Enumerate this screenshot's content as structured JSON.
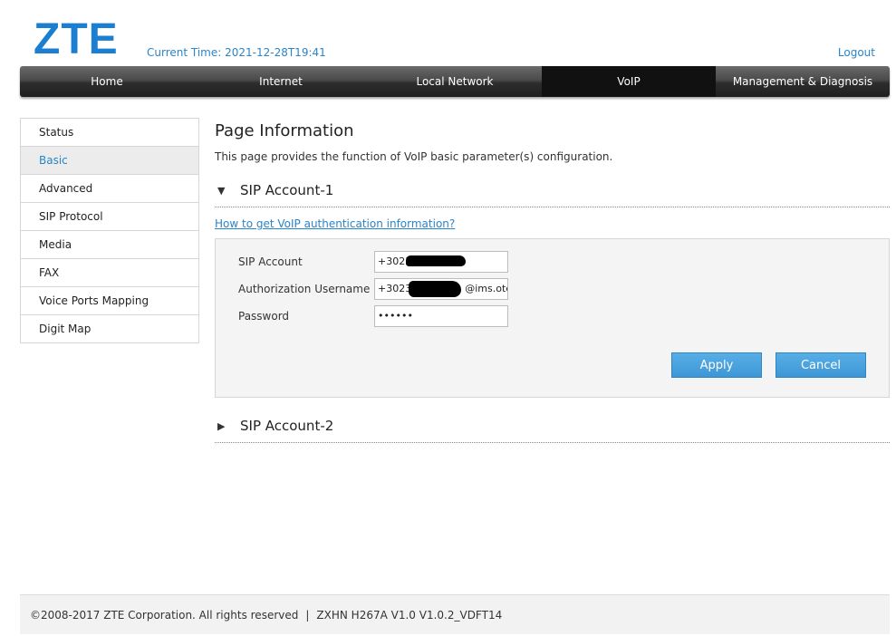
{
  "header": {
    "logo": "ZTE",
    "current_time": "Current Time: 2021-12-28T19:41",
    "logout": "Logout"
  },
  "nav": {
    "items": [
      "Home",
      "Internet",
      "Local Network",
      "VoIP",
      "Management & Diagnosis"
    ],
    "active": "VoIP"
  },
  "sidebar": {
    "items": [
      "Status",
      "Basic",
      "Advanced",
      "SIP Protocol",
      "Media",
      "FAX",
      "Voice Ports Mapping",
      "Digit Map"
    ],
    "active": "Basic"
  },
  "page": {
    "title": "Page Information",
    "description": "This page provides the function of VoIP basic parameter(s) configuration."
  },
  "sip1": {
    "title": "SIP Account-1",
    "arrow": "▼",
    "help_link": "How to get VoIP authentication information?",
    "fields": {
      "sip_account_label": "SIP Account",
      "sip_account_value": "+3023",
      "auth_user_label": "Authorization Username",
      "auth_user_prefix": "+3023",
      "auth_user_suffix": "@ims.ote",
      "password_label": "Password",
      "password_value": "••••••"
    },
    "apply_label": "Apply",
    "cancel_label": "Cancel"
  },
  "sip2": {
    "title": "SIP Account-2",
    "arrow": "▶"
  },
  "footer": {
    "copyright": "©2008-2017 ZTE Corporation. All rights reserved",
    "separator": "|",
    "model": "ZXHN H267A V1.0 V1.0.2_VDFT14"
  },
  "colors": {
    "brand_blue": "#1a7ed1",
    "link_blue": "#2a84c8",
    "button_blue": "#4aa3e0",
    "nav_dark": "#2d2d2d"
  }
}
